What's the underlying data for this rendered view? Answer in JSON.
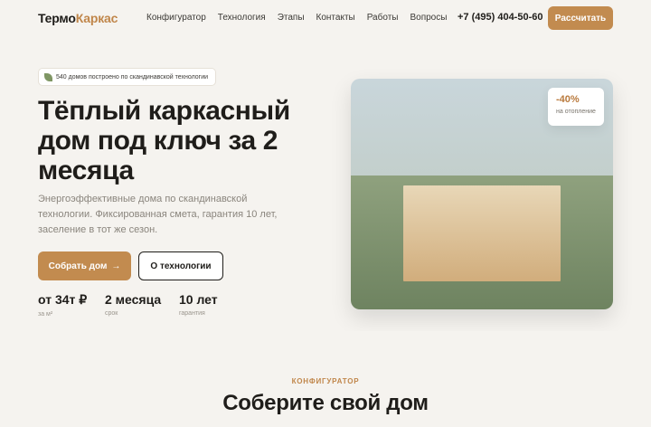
{
  "header": {
    "logo_part1": "Термо",
    "logo_part2": "Каркас",
    "nav": [
      "Конфигуратор",
      "Технология",
      "Этапы",
      "Контакты",
      "Работы",
      "Вопросы"
    ],
    "phone": "+7 (495) 404-50-60",
    "cta_label": "Рассчитать"
  },
  "hero": {
    "badge": "540 домов построено по скандинавской технологии",
    "title": "Тёплый каркасный дом под ключ за 2 месяца",
    "lead": "Энергоэффективные дома по скандинавской технологии. Фиксированная смета, гарантия 10 лет, заселение в тот же сезон.",
    "primary_btn": "Собрать дом",
    "primary_btn_arrow": "→",
    "secondary_btn": "О технологии",
    "stats": [
      {
        "value": "от 34т ₽",
        "label": "за м²"
      },
      {
        "value": "2 месяца",
        "label": "срок"
      },
      {
        "value": "10 лет",
        "label": "гарантия"
      }
    ],
    "saving_value": "-40%",
    "saving_label": "на отопление"
  },
  "configurator": {
    "eyebrow": "КОНФИГУРАТОР",
    "title": "Соберите свой дом"
  },
  "colors": {
    "accent": "#c28b4f",
    "background": "#f5f3ef",
    "text": "#1f1d1a"
  }
}
